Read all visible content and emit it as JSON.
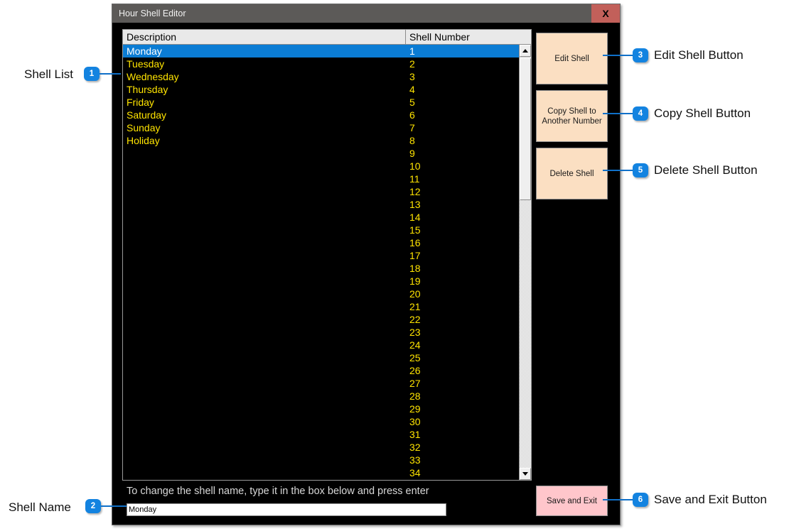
{
  "window": {
    "title": "Hour Shell Editor",
    "close_label": "X"
  },
  "list": {
    "headers": [
      "Description",
      "Shell Number"
    ],
    "selected_index": 0,
    "rows": [
      {
        "description": "Monday",
        "number": "1"
      },
      {
        "description": "Tuesday",
        "number": "2"
      },
      {
        "description": "Wednesday",
        "number": "3"
      },
      {
        "description": "Thursday",
        "number": "4"
      },
      {
        "description": "Friday",
        "number": "5"
      },
      {
        "description": "Saturday",
        "number": "6"
      },
      {
        "description": "Sunday",
        "number": "7"
      },
      {
        "description": "Holiday",
        "number": "8"
      },
      {
        "description": "",
        "number": "9"
      },
      {
        "description": "",
        "number": "10"
      },
      {
        "description": "",
        "number": "11"
      },
      {
        "description": "",
        "number": "12"
      },
      {
        "description": "",
        "number": "13"
      },
      {
        "description": "",
        "number": "14"
      },
      {
        "description": "",
        "number": "15"
      },
      {
        "description": "",
        "number": "16"
      },
      {
        "description": "",
        "number": "17"
      },
      {
        "description": "",
        "number": "18"
      },
      {
        "description": "",
        "number": "19"
      },
      {
        "description": "",
        "number": "20"
      },
      {
        "description": "",
        "number": "21"
      },
      {
        "description": "",
        "number": "22"
      },
      {
        "description": "",
        "number": "23"
      },
      {
        "description": "",
        "number": "24"
      },
      {
        "description": "",
        "number": "25"
      },
      {
        "description": "",
        "number": "26"
      },
      {
        "description": "",
        "number": "27"
      },
      {
        "description": "",
        "number": "28"
      },
      {
        "description": "",
        "number": "29"
      },
      {
        "description": "",
        "number": "30"
      },
      {
        "description": "",
        "number": "31"
      },
      {
        "description": "",
        "number": "32"
      },
      {
        "description": "",
        "number": "33"
      },
      {
        "description": "",
        "number": "34"
      }
    ]
  },
  "buttons": {
    "edit": "Edit Shell",
    "copy": "Copy Shell to Another Number",
    "delete": "Delete Shell",
    "save": "Save and Exit"
  },
  "bottom": {
    "hint": "To change the shell name, type it in the box below and press enter",
    "name_value": "Monday",
    "name_placeholder": ""
  },
  "callouts": [
    {
      "number": "1",
      "label": "Shell List"
    },
    {
      "number": "2",
      "label": "Shell Name"
    },
    {
      "number": "3",
      "label": "Edit Shell Button"
    },
    {
      "number": "4",
      "label": "Copy Shell Button"
    },
    {
      "number": "5",
      "label": "Delete Shell Button"
    },
    {
      "number": "6",
      "label": "Save and Exit Button"
    }
  ],
  "colors": {
    "accent_badge": "#1383e0",
    "selection": "#0b7cd4",
    "list_text": "#ffe400",
    "button_face": "#fbdfc2",
    "save_button_face": "#ffc6cb",
    "close_button": "#c2605a",
    "titlebar": "#5c5a58"
  }
}
